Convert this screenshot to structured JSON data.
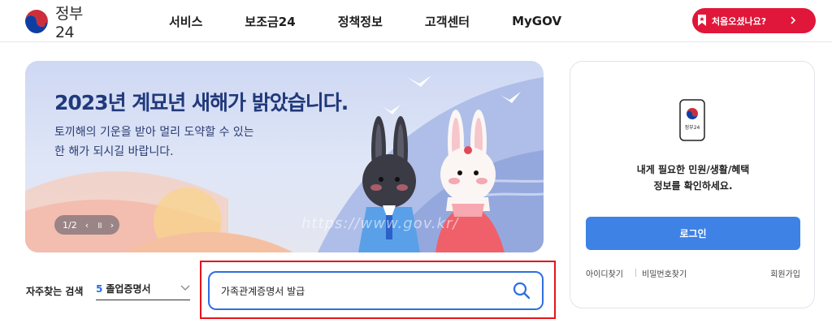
{
  "header": {
    "logo_text": "정부24",
    "nav": [
      "서비스",
      "보조금24",
      "정책정보",
      "고객센터",
      "MyGOV"
    ],
    "cta_label": "처음오셨나요?",
    "brand_color": "#e0173a"
  },
  "banner": {
    "title": "2023년 계묘년 새해가 밝았습니다.",
    "subtitle_line1": "토끼해의 기운을 받아 멀리 도약할 수 있는",
    "subtitle_line2": "한 해가 되시길 바랍니다.",
    "pager_text": "1/2",
    "pager_prev": "‹",
    "pager_pause": "॥",
    "pager_next": "›",
    "watermark": "https://www.gov.kr/"
  },
  "frequent_search": {
    "label": "자주찾는 검색",
    "selected_num": "5",
    "selected_text": "졸업증명서"
  },
  "search": {
    "value": "가족관계증명서 발급",
    "accent_color": "#2f6fdf"
  },
  "login": {
    "phone_label": "정부24",
    "message_line1": "내게 필요한 민원/생활/혜택",
    "message_line2": "정보를 확인하세요.",
    "login_button": "로그인",
    "find_id": "아이디찾기",
    "find_pw": "비밀번호찾기",
    "signup": "회원가입",
    "button_color": "#3e82e6"
  }
}
